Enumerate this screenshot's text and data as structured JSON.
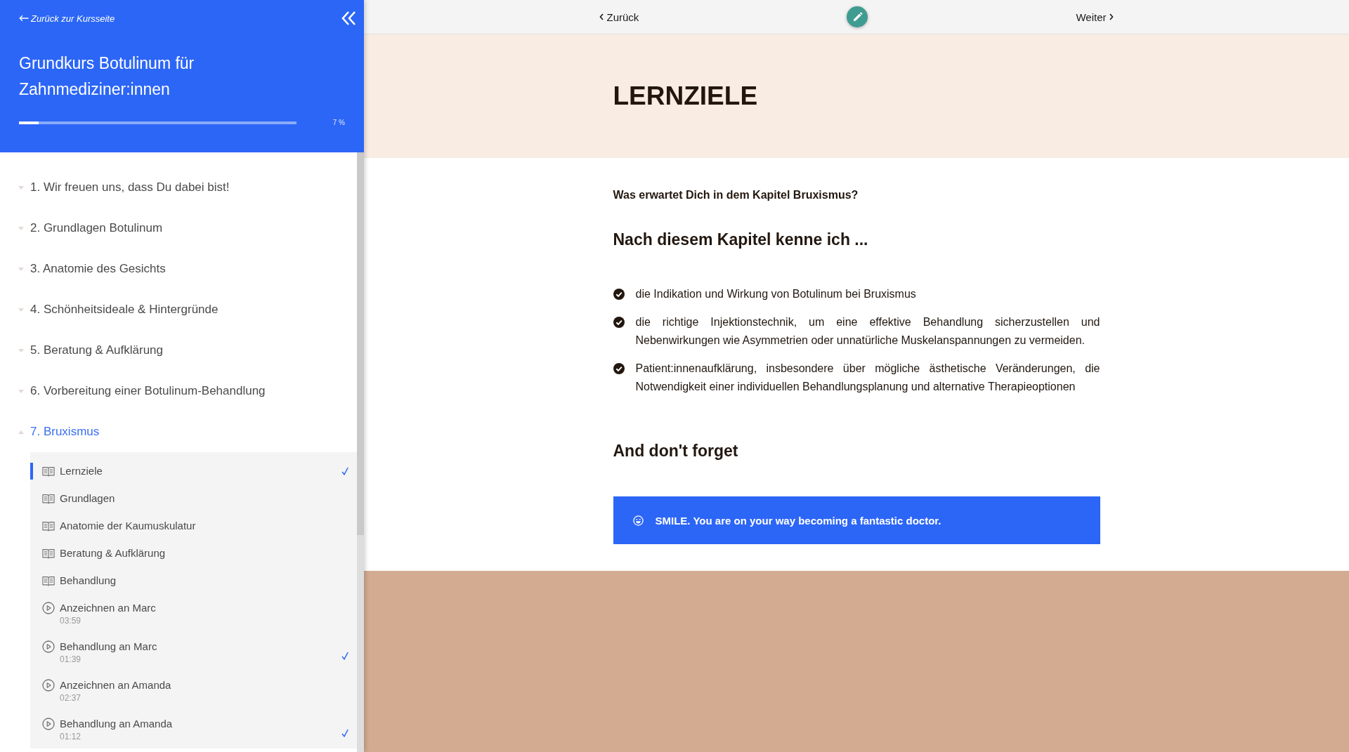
{
  "sidebar": {
    "back_link": "Zurück zur Kursseite",
    "course_title": "Grundkurs Botulinum für Zahnmediziner:innen",
    "progress": {
      "level": 0.07,
      "reading": "7 %"
    },
    "chapters": [
      {
        "title": "1. Wir freuen uns, dass Du dabei bist!",
        "expanded": false,
        "selected": false
      },
      {
        "title": "2. Grundlagen Botulinum",
        "expanded": false,
        "selected": false
      },
      {
        "title": "3. Anatomie des Gesichts",
        "expanded": false,
        "selected": false
      },
      {
        "title": "4. Schönheitsideale & Hintergründe",
        "expanded": false,
        "selected": false
      },
      {
        "title": "5. Beratung & Aufklärung",
        "expanded": false,
        "selected": false
      },
      {
        "title": "6. Vorbereitung einer Botulinum-Behandlung",
        "expanded": false,
        "selected": false
      },
      {
        "title": "7. Bruxismus",
        "expanded": true,
        "selected": true,
        "children": [
          {
            "kind": "text",
            "title": "Lernziele",
            "selected": true,
            "completed": true
          },
          {
            "kind": "text",
            "title": "Grundlagen",
            "selected": false,
            "completed": false
          },
          {
            "kind": "text",
            "title": "Anatomie der Kaumuskulatur",
            "selected": false,
            "completed": false
          },
          {
            "kind": "text",
            "title": "Beratung & Aufklärung",
            "selected": false,
            "completed": false
          },
          {
            "kind": "text",
            "title": "Behandlung",
            "selected": false,
            "completed": false
          },
          {
            "kind": "video",
            "title": "Anzeichnen an Marc",
            "duration": "03:59",
            "selected": false,
            "completed": false
          },
          {
            "kind": "video",
            "title": "Behandlung an Marc",
            "duration": "01:39",
            "selected": false,
            "completed": true
          },
          {
            "kind": "video",
            "title": "Anzeichnen an Amanda",
            "duration": "02:37",
            "selected": false,
            "completed": false
          },
          {
            "kind": "video",
            "title": "Behandlung an Amanda",
            "duration": "01:12",
            "selected": false,
            "completed": true
          }
        ]
      }
    ]
  },
  "top_nav": {
    "previous": "Zurück",
    "next": "Weiter"
  },
  "page": {
    "title": "LERNZIELE",
    "intro": "Was erwartet Dich in dem Kapitel Bruxismus?",
    "heading": "Nach diesem Kapitel kenne ich ...",
    "goals": [
      "die Indikation und Wirkung von Botulinum bei Bruxismus",
      "die richtige Injektionstechnik, um eine effektive Behandlung sicherzustellen und Nebenwirkungen wie Asymmetrien oder unnatürliche Muskelanspannungen zu vermeiden.",
      "Patient:innenaufklärung, insbesondere über mögliche ästhetische Veränderungen, die Notwendigkeit einer individuellen Behandlungsplanung und alternative Therapieoptionen"
    ],
    "reminder_heading": "And don't forget",
    "callout": "SMILE. You are on your way becoming a fantastic doctor."
  }
}
